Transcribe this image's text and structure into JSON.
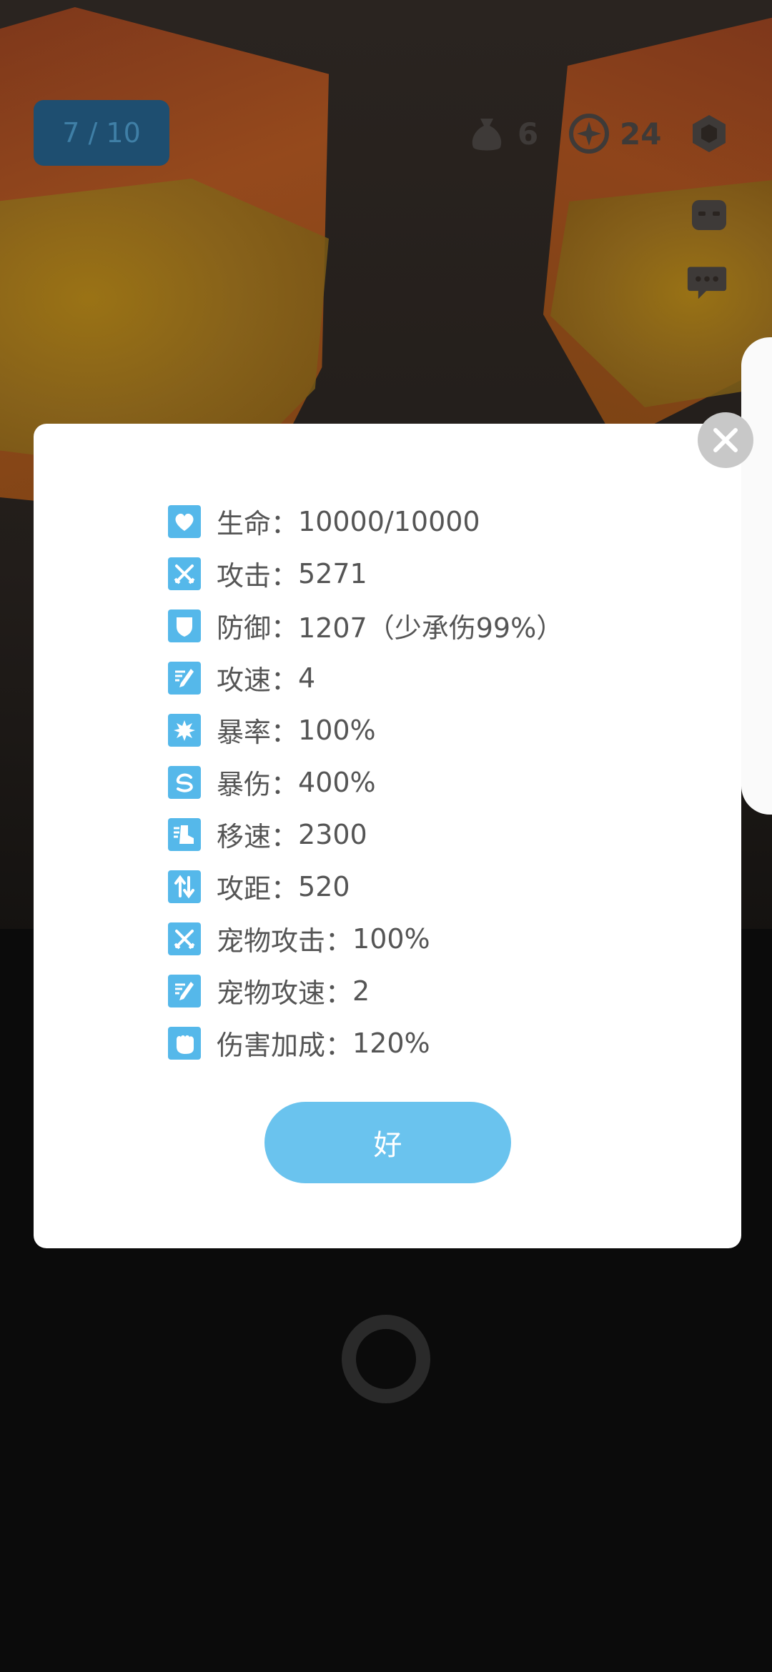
{
  "hud": {
    "level": "7 / 10",
    "bag_count": "6",
    "coin_count": "24"
  },
  "icons": {
    "bag": "money-bag-icon",
    "coin": "coin-icon",
    "settings": "hexagon-settings-icon",
    "face": "robot-face-icon",
    "chat": "chat-bubble-icon",
    "close": "close-icon"
  },
  "stats": [
    {
      "label": "生命",
      "value": "10000/10000",
      "icon": "heart-icon"
    },
    {
      "label": "攻击",
      "value": "5271",
      "icon": "crossed-swords-icon"
    },
    {
      "label": "防御",
      "value": "1207（少承伤99%）",
      "icon": "shield-icon"
    },
    {
      "label": "攻速",
      "value": "4",
      "icon": "quill-speed-icon"
    },
    {
      "label": "暴率",
      "value": "100%",
      "icon": "burst-icon"
    },
    {
      "label": "暴伤",
      "value": "400%",
      "icon": "swirl-icon"
    },
    {
      "label": "移速",
      "value": "2300",
      "icon": "boot-icon"
    },
    {
      "label": "攻距",
      "value": "520",
      "icon": "range-arrows-icon"
    },
    {
      "label": "宠物攻击",
      "value": "100%",
      "icon": "crossed-swords-icon"
    },
    {
      "label": "宠物攻速",
      "value": "2",
      "icon": "quill-speed-icon"
    },
    {
      "label": "伤害加成",
      "value": "120%",
      "icon": "fist-icon"
    }
  ],
  "separator": "：",
  "ok_label": "好",
  "colors": {
    "accent": "#55b8ea",
    "button": "#6ac3ee",
    "text": "#555555"
  }
}
